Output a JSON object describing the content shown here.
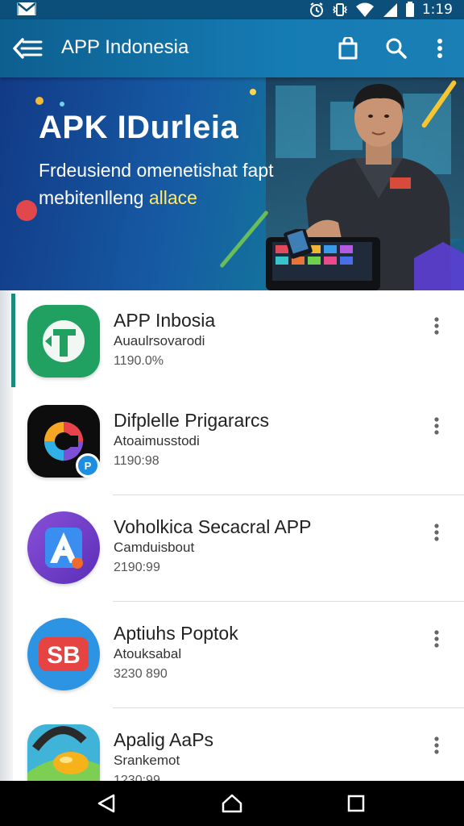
{
  "status_bar": {
    "time": "1:19",
    "icons": [
      "gmail-icon",
      "alarm-icon",
      "vibrate-icon",
      "wifi-icon",
      "signal-icon",
      "battery-icon"
    ]
  },
  "app_bar": {
    "title": "APP Indonesia",
    "icons": [
      "back-menu-icon",
      "shopping-bag-icon",
      "search-icon",
      "more-vert-icon"
    ]
  },
  "banner": {
    "headline": "APK IDurleia",
    "line1": "Frdeusiend omenetishat fapt",
    "line2_white": "mebitenlleng",
    "line2_yellow": "allace"
  },
  "apps": [
    {
      "name": "APP Inbosia",
      "developer": "Auaulrsovarodi",
      "meta": "1190.0%",
      "icon": "green-t-app-icon"
    },
    {
      "name": "Difplelle Prigararcs",
      "developer": "Atoaimusstodi",
      "meta": "1190:98",
      "icon": "colorful-c-app-icon"
    },
    {
      "name": "Voholkica Secacral APP",
      "developer": "Camduisbout",
      "meta": "2190:99",
      "icon": "purple-a-app-icon"
    },
    {
      "name": "Aptiuhs Poptok",
      "developer": "Atouksabal",
      "meta": "3230 890",
      "icon": "red-sb-app-icon"
    },
    {
      "name": "Apalig AaPs",
      "developer": "Srankemot",
      "meta": "1230:99",
      "icon": "game-app-icon"
    }
  ],
  "colors": {
    "app_bar": "#157bb3",
    "status_bar": "#0b4f7a",
    "banner_start": "#123a86",
    "banner_end": "#1b5f82",
    "accent_yellow": "#ffe86b"
  },
  "nav_bar": {
    "icons": [
      "back-triangle-icon",
      "home-icon",
      "recents-square-icon"
    ]
  }
}
